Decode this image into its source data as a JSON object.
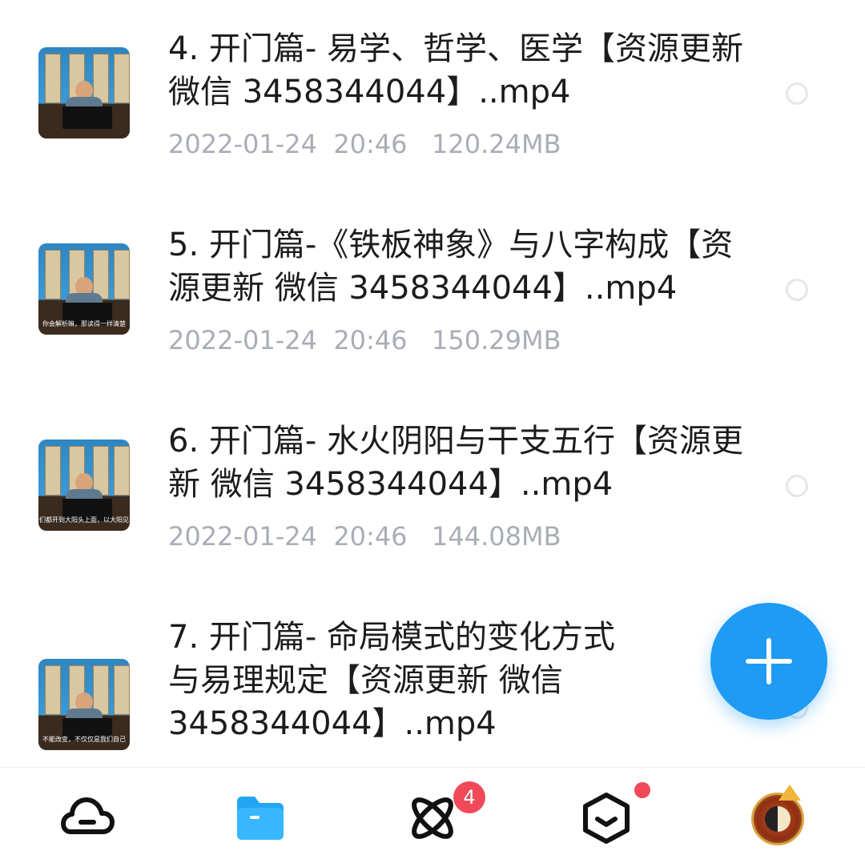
{
  "files": [
    {
      "title": "4. 开门篇- 易学、哲学、医学【资源更新 微信 3458344044】..mp4",
      "date": "2022-01-24",
      "time": "20:46",
      "size": "120.24MB",
      "caption": ""
    },
    {
      "title": "5. 开门篇-《铁板神象》与八字构成【资源更新 微信 3458344044】..mp4",
      "date": "2022-01-24",
      "time": "20:46",
      "size": "150.29MB",
      "caption": "你会解析嘛，那读得一样清楚"
    },
    {
      "title": "6. 开门篇- 水火阴阳与干支五行【资源更新 微信 3458344044】..mp4",
      "date": "2022-01-24",
      "time": "20:46",
      "size": "144.08MB",
      "caption": "们都开到大阳头上面，以大阳见"
    },
    {
      "title": "7. 开门篇- 命局模式的变化方式与易理规定【资源更新 微信 3458344044】..mp4",
      "date": "",
      "time": "",
      "size": "",
      "caption": "不能改变，不仅仅是我们自己"
    }
  ],
  "tabbar": {
    "tabs": [
      {
        "icon": "cloud-icon"
      },
      {
        "icon": "folder-icon",
        "active": true
      },
      {
        "icon": "atom-icon",
        "badge": "4"
      },
      {
        "icon": "box-icon",
        "dot": true
      },
      {
        "icon": "avatar-icon"
      }
    ]
  },
  "colors": {
    "accent": "#1e9bf2",
    "badge": "#f04a5a",
    "meta_text": "#a9adb7",
    "title_text": "#1c1c1e"
  }
}
